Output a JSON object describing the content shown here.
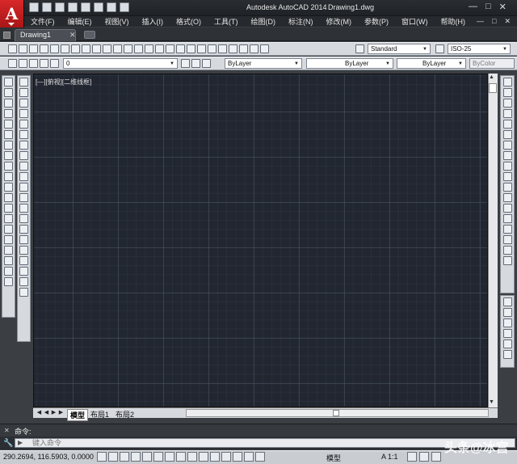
{
  "window": {
    "app_title": "Autodesk AutoCAD 2014",
    "doc_title": "Drawing1.dwg",
    "min": "—",
    "max": "□",
    "close": "✕",
    "logo_letter": "A"
  },
  "menu": [
    "文件(F)",
    "编辑(E)",
    "视图(V)",
    "插入(I)",
    "格式(O)",
    "工具(T)",
    "绘图(D)",
    "标注(N)",
    "修改(M)",
    "参数(P)",
    "窗口(W)",
    "帮助(H)"
  ],
  "menubar_right": [
    "—",
    "□",
    "✕"
  ],
  "tabs": {
    "active": "Drawing1",
    "close": "✕"
  },
  "toolbar1": {
    "text_style": "Standard",
    "dim_style": "ISO-25"
  },
  "toolbar2": {
    "layer": "0",
    "color": "ByLayer",
    "linetype": "ByLayer",
    "lineweight": "ByLayer",
    "plotstyle": "ByColor"
  },
  "viewport": {
    "label": "[—][俯视][二维线框]"
  },
  "layout_tabs": [
    "模型",
    "布局1",
    "布局2"
  ],
  "command": {
    "history": "命令:",
    "placeholder": "键入命令"
  },
  "status": {
    "coords": "290.2694,  116.5903, 0.0000",
    "model": "模型",
    "scale": "A 1:1"
  },
  "watermark": "头条@冰宫",
  "colors": {
    "canvas": "#212630",
    "titlebar": "#2a2d31",
    "toolbar": "#d6d9de",
    "logo": "#c41f21"
  }
}
